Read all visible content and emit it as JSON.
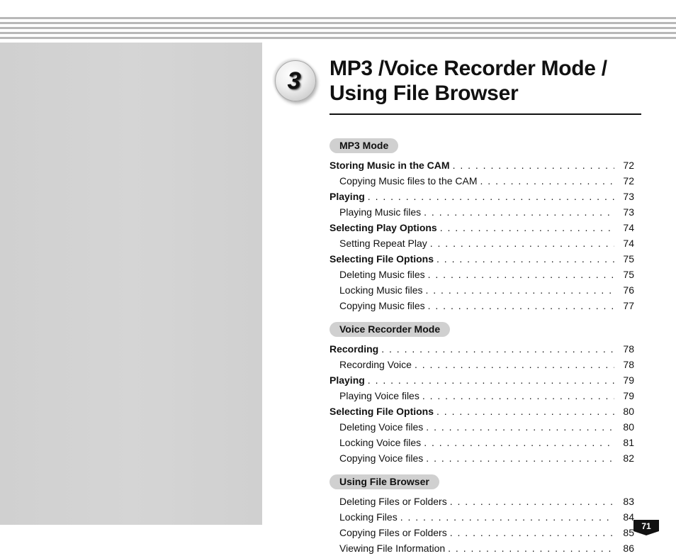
{
  "chapter": {
    "number": "3",
    "title_l1": "MP3 /Voice Recorder Mode /",
    "title_l2": "Using File Browser"
  },
  "sections": [
    {
      "heading": "MP3 Mode",
      "items": [
        {
          "label": "Storing Music in the CAM",
          "page": "72",
          "bold": true
        },
        {
          "label": "Copying Music files to the CAM",
          "page": "72",
          "bold": false,
          "sub": true
        },
        {
          "label": "Playing",
          "page": "73",
          "bold": true
        },
        {
          "label": "Playing Music files",
          "page": "73",
          "bold": false,
          "sub": true
        },
        {
          "label": "Selecting Play Options",
          "page": "74",
          "bold": true
        },
        {
          "label": "Setting Repeat Play",
          "page": "74",
          "bold": false,
          "sub": true
        },
        {
          "label": "Selecting File Options",
          "page": "75",
          "bold": true
        },
        {
          "label": "Deleting Music files",
          "page": "75",
          "bold": false,
          "sub": true
        },
        {
          "label": "Locking Music files",
          "page": "76",
          "bold": false,
          "sub": true
        },
        {
          "label": "Copying Music files",
          "page": "77",
          "bold": false,
          "sub": true
        }
      ]
    },
    {
      "heading": "Voice Recorder Mode",
      "items": [
        {
          "label": "Recording",
          "page": "78",
          "bold": true
        },
        {
          "label": "Recording Voice",
          "page": "78",
          "bold": false,
          "sub": true
        },
        {
          "label": "Playing",
          "page": "79",
          "bold": true
        },
        {
          "label": "Playing Voice files",
          "page": "79",
          "bold": false,
          "sub": true
        },
        {
          "label": "Selecting File Options",
          "page": "80",
          "bold": true
        },
        {
          "label": "Deleting Voice files",
          "page": "80",
          "bold": false,
          "sub": true
        },
        {
          "label": "Locking Voice files",
          "page": "81",
          "bold": false,
          "sub": true
        },
        {
          "label": "Copying Voice files",
          "page": "82",
          "bold": false,
          "sub": true
        }
      ]
    },
    {
      "heading": "Using File Browser",
      "items": [
        {
          "label": "Deleting Files or Folders",
          "page": "83",
          "bold": false,
          "sub": true
        },
        {
          "label": "Locking Files",
          "page": "84",
          "bold": false,
          "sub": true
        },
        {
          "label": "Copying Files or Folders",
          "page": "85",
          "bold": false,
          "sub": true
        },
        {
          "label": "Viewing File Information",
          "page": "86",
          "bold": false,
          "sub": true
        }
      ]
    }
  ],
  "page_number": "71"
}
